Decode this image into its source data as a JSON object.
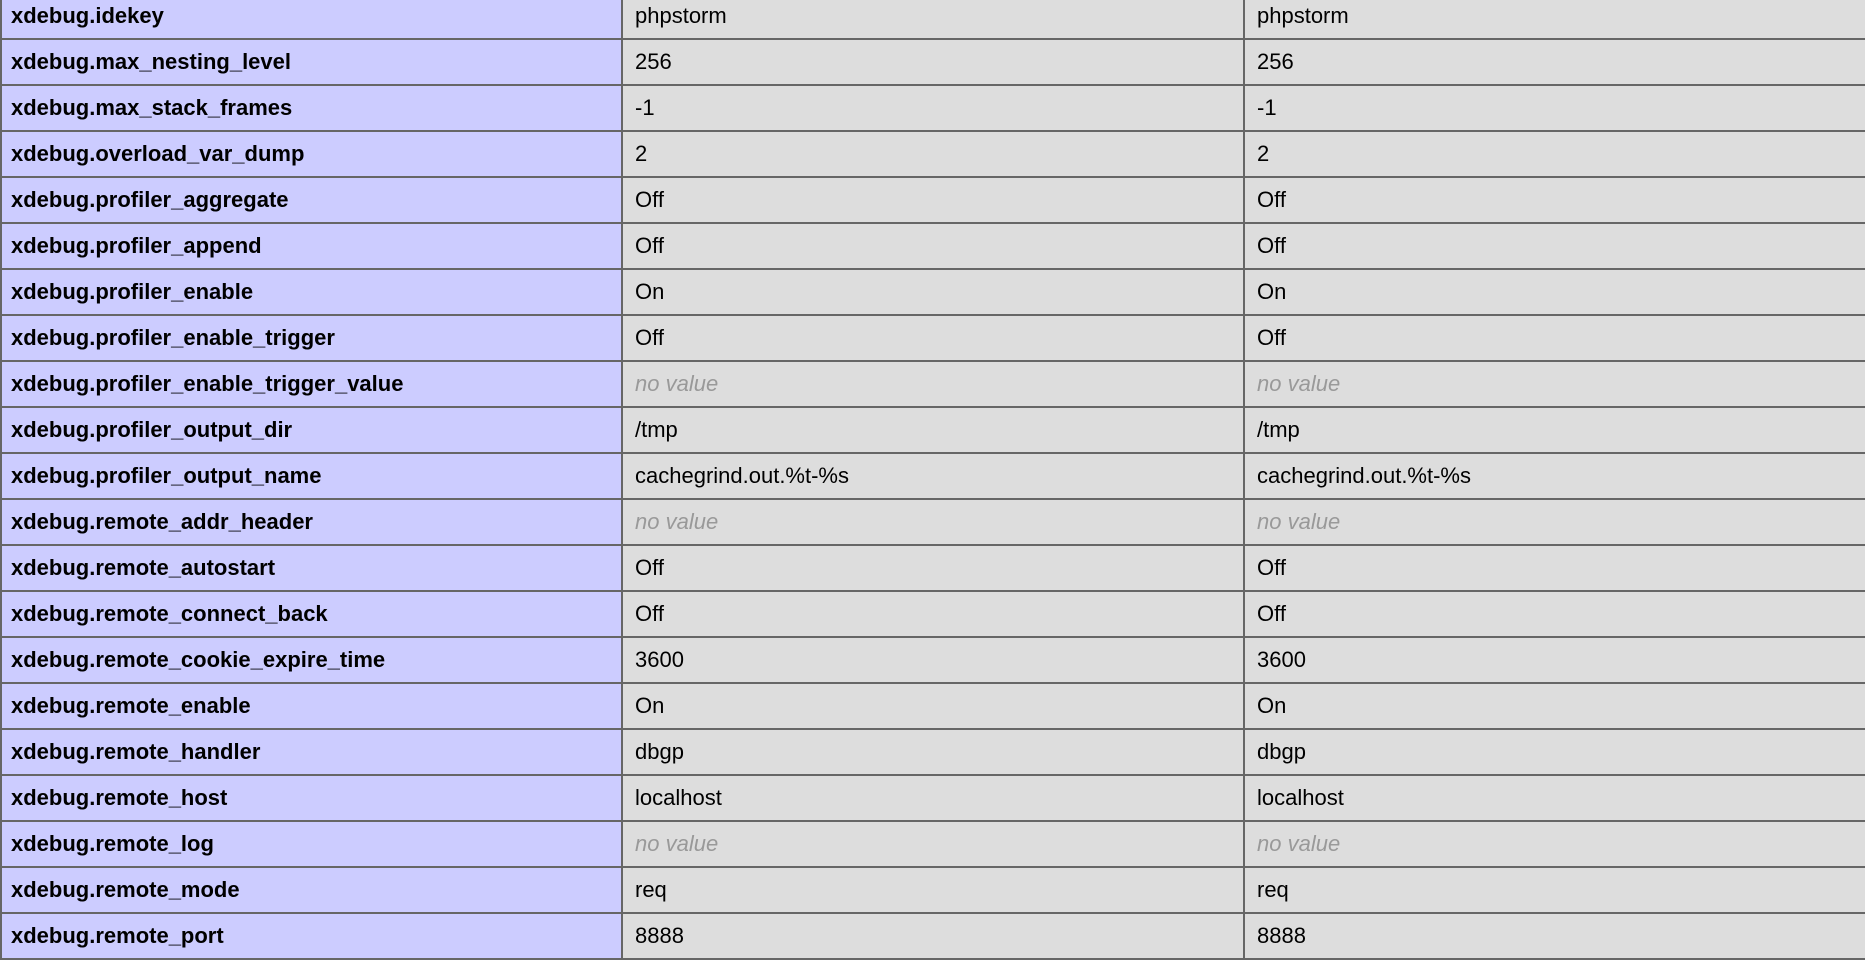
{
  "directives": [
    {
      "name": "xdebug.idekey",
      "local": "phpstorm",
      "master": "phpstorm"
    },
    {
      "name": "xdebug.max_nesting_level",
      "local": "256",
      "master": "256"
    },
    {
      "name": "xdebug.max_stack_frames",
      "local": "-1",
      "master": "-1"
    },
    {
      "name": "xdebug.overload_var_dump",
      "local": "2",
      "master": "2"
    },
    {
      "name": "xdebug.profiler_aggregate",
      "local": "Off",
      "master": "Off"
    },
    {
      "name": "xdebug.profiler_append",
      "local": "Off",
      "master": "Off"
    },
    {
      "name": "xdebug.profiler_enable",
      "local": "On",
      "master": "On"
    },
    {
      "name": "xdebug.profiler_enable_trigger",
      "local": "Off",
      "master": "Off"
    },
    {
      "name": "xdebug.profiler_enable_trigger_value",
      "local": "no value",
      "master": "no value"
    },
    {
      "name": "xdebug.profiler_output_dir",
      "local": "/tmp",
      "master": "/tmp"
    },
    {
      "name": "xdebug.profiler_output_name",
      "local": "cachegrind.out.%t-%s",
      "master": "cachegrind.out.%t-%s"
    },
    {
      "name": "xdebug.remote_addr_header",
      "local": "no value",
      "master": "no value"
    },
    {
      "name": "xdebug.remote_autostart",
      "local": "Off",
      "master": "Off"
    },
    {
      "name": "xdebug.remote_connect_back",
      "local": "Off",
      "master": "Off"
    },
    {
      "name": "xdebug.remote_cookie_expire_time",
      "local": "3600",
      "master": "3600"
    },
    {
      "name": "xdebug.remote_enable",
      "local": "On",
      "master": "On"
    },
    {
      "name": "xdebug.remote_handler",
      "local": "dbgp",
      "master": "dbgp"
    },
    {
      "name": "xdebug.remote_host",
      "local": "localhost",
      "master": "localhost"
    },
    {
      "name": "xdebug.remote_log",
      "local": "no value",
      "master": "no value"
    },
    {
      "name": "xdebug.remote_mode",
      "local": "req",
      "master": "req"
    },
    {
      "name": "xdebug.remote_port",
      "local": "8888",
      "master": "8888"
    }
  ],
  "colors": {
    "key_bg": "#ccccff",
    "value_bg": "#dddddd",
    "border": "#666666",
    "no_value_text": "#999999"
  }
}
